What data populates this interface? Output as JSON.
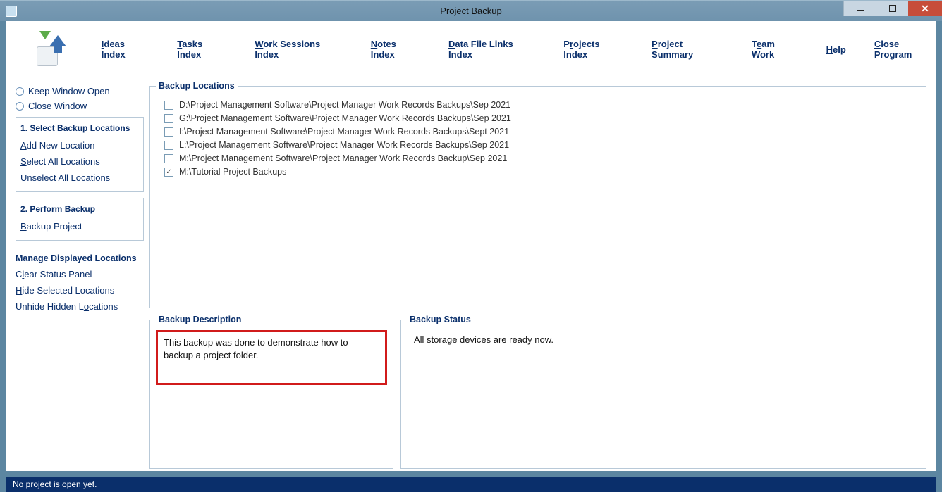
{
  "window": {
    "title": "Project Backup"
  },
  "menu": {
    "ideas": "Ideas Index",
    "tasks": "Tasks Index",
    "sessions": "Work Sessions Index",
    "notes": "Notes Index",
    "datafiles": "Data File Links Index",
    "projects": "Projects Index",
    "summary": "Project Summary",
    "teamwork": "Team Work",
    "help": "Help",
    "close": "Close Program"
  },
  "sidebar": {
    "keep_open": "Keep Window Open",
    "close_window": "Close Window",
    "group1_title": "1. Select Backup Locations",
    "add_new": "Add New Location",
    "select_all": "Select All Locations",
    "unselect_all": "Unselect All Locations",
    "group2_title": "2. Perform Backup",
    "backup_project": "Backup Project",
    "manage_heading": "Manage Displayed Locations",
    "clear_status": "Clear Status Panel",
    "hide_selected": "Hide Selected Locations",
    "unhide_hidden": "Unhide Hidden Locations"
  },
  "locations": {
    "legend": "Backup Locations",
    "items": [
      {
        "checked": false,
        "path": "D:\\Project Management Software\\Project Manager Work Records Backups\\Sep 2021"
      },
      {
        "checked": false,
        "path": "G:\\Project Management Software\\Project Manager Work Records Backups\\Sep 2021"
      },
      {
        "checked": false,
        "path": "I:\\Project Management Software\\Project Manager Work Records Backups\\Sept 2021"
      },
      {
        "checked": false,
        "path": "L:\\Project Management Software\\Project Manager Work Records Backups\\Sep 2021"
      },
      {
        "checked": false,
        "path": "M:\\Project Management Software\\Project Manager Work Records Backup\\Sep 2021"
      },
      {
        "checked": true,
        "path": "M:\\Tutorial Project Backups"
      }
    ]
  },
  "description": {
    "legend": "Backup Description",
    "text": "This backup was done to demonstrate how to backup a project folder."
  },
  "status": {
    "legend": "Backup Status",
    "text": "All storage devices are ready now."
  },
  "statusbar": {
    "text": "No project is open yet."
  }
}
